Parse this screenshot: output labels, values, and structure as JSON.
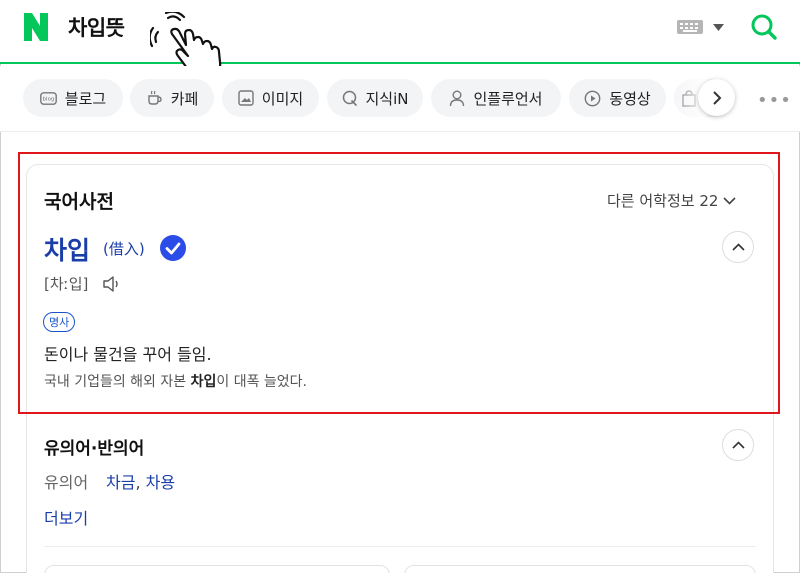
{
  "header": {
    "query": "차입뜻",
    "logo_color": "#03c75a",
    "accent_color": "#03c75a"
  },
  "tabs": [
    {
      "label": "블로그",
      "icon": "blog-icon"
    },
    {
      "label": "카페",
      "icon": "cafe-icon"
    },
    {
      "label": "이미지",
      "icon": "image-icon"
    },
    {
      "label": "지식iN",
      "icon": "kin-icon"
    },
    {
      "label": "인플루언서",
      "icon": "person-icon"
    },
    {
      "label": "동영상",
      "icon": "play-icon"
    }
  ],
  "dictionary": {
    "section_title": "국어사전",
    "other_info": "다른 어학정보 22",
    "word": "차입",
    "hanja": "(借入)",
    "pronunciation": "[차ː입]",
    "pos": "명사",
    "meaning": "돈이나 물건을 꾸어 들임.",
    "example_before": "국내 기업들의 해외 자본 ",
    "example_bold": "차입",
    "example_after": "이 대폭 늘었다.",
    "highlight_color": "#e0161a",
    "word_color": "#1a3ea8"
  },
  "synonyms": {
    "title": "유의어·반의어",
    "label": "유의어",
    "word1": "차금",
    "separator": ",",
    "word2": "차용",
    "more": "더보기"
  }
}
